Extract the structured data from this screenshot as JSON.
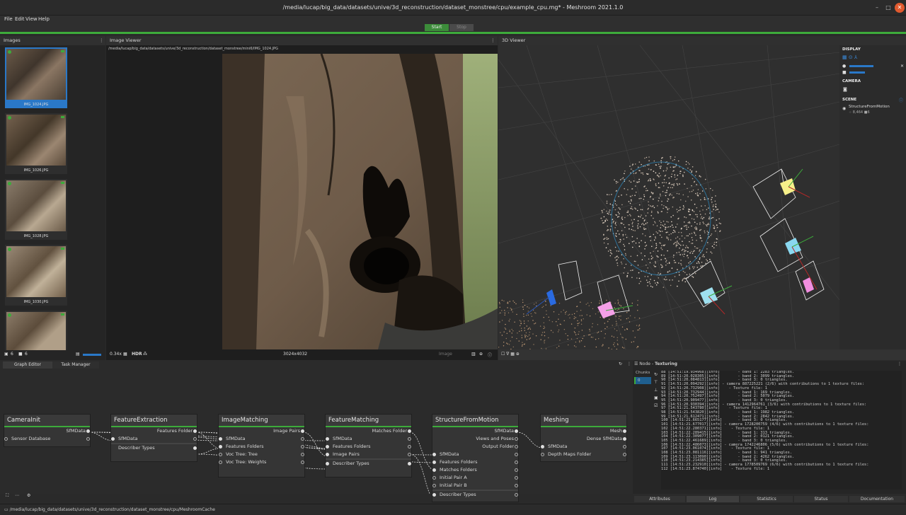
{
  "window": {
    "title": "/media/lucap/big_data/datasets/unive/3d_reconstruction/dataset_monstree/cpu/example_cpu.mg* - Meshroom 2021.1.0"
  },
  "menu": [
    "File",
    "Edit",
    "View",
    "Help"
  ],
  "toolbar": {
    "start": "Start",
    "stop": "Stop"
  },
  "images_panel": {
    "title": "Images",
    "items": [
      {
        "label": "IMG_1024.JPG"
      },
      {
        "label": "IMG_1026.JPG"
      },
      {
        "label": "IMG_1028.JPG"
      },
      {
        "label": "IMG_1030.JPG"
      },
      {
        "label": ""
      }
    ],
    "count_images": "6",
    "count_cameras": "6"
  },
  "image_viewer": {
    "title": "Image Viewer",
    "path": "/media/lucap/big_data/datasets/unive/3d_reconstruction/dataset_monstree/mini6/IMG_1024.JPG",
    "zoom": "0.34x",
    "hdr": "HDR",
    "resolution": "3024x4032",
    "mode": "Image"
  },
  "viewer3d": {
    "title": "3D Viewer",
    "display_label": "DISPLAY",
    "camera_label": "CAMERA",
    "scene_label": "SCENE",
    "scene_item": "StructureFromMotion",
    "scene_points": "8,464",
    "scene_cams": "6"
  },
  "tabs": {
    "graph_editor": "Graph Editor",
    "task_manager": "Task Manager"
  },
  "nodes": {
    "camerainit": {
      "title": "CameraInit",
      "out": "SfMData",
      "in1": "Sensor Database"
    },
    "featureextraction": {
      "title": "FeatureExtraction",
      "out": "Features Folder",
      "in1": "SfMData",
      "in2": "Describer Types"
    },
    "imagematching": {
      "title": "ImageMatching",
      "out": "Image Pairs",
      "in1": "SfMData",
      "in2": "Features Folders",
      "in3": "Voc Tree: Tree",
      "in4": "Voc Tree: Weights"
    },
    "featurematching": {
      "title": "FeatureMatching",
      "out": "Matches Folder",
      "in1": "SfMData",
      "in2": "Features Folders",
      "in3": "Image Pairs",
      "in4": "Describer Types"
    },
    "sfm": {
      "title": "StructureFromMotion",
      "out1": "SfMData",
      "out2": "Views and Poses",
      "out3": "Output Folder",
      "in1": "SfMData",
      "in2": "Features Folders",
      "in3": "Matches Folders",
      "in4": "Initial Pair A",
      "in5": "Initial Pair B",
      "in6": "Describer Types"
    },
    "meshing": {
      "title": "Meshing",
      "out1": "Mesh",
      "out2": "Dense SfMData",
      "in1": "SfMData",
      "in2": "Depth Maps Folder"
    }
  },
  "log_panel": {
    "node_label": "Node - ",
    "node_name": "Texturing",
    "chunks_label": "Chunks",
    "chunk0": "0",
    "lines": [
      "88 [14:51:19.934968][info]        - band 1: 2283 triangles.",
      "89 [14:51:20.028305][info]        - band 2: 3099 triangles.",
      "90 [14:51:20.084813][info]        - band 3: 0 triangles.",
      "91 [14:51:20.094292][info] - camera 887225221 (2/6) with contributions to 1 texture files:",
      "92 [14:51:20.732908][info]    - Texture file: 1",
      "93 [14:51:20.732944][info]        - band 1: 169 triangles.",
      "94 [14:51:20.752497][info]        - band 2: 5079 triangles.",
      "95 [14:51:20.909477][info]        - band 3: 0 triangles.",
      "96 [14:51:20.930394][info] - camera 1412964761 (3/6) with contributions to 1 texture files:",
      "97 [14:51:21.543780][info]    - Texture file: 1",
      "98 [14:51:21.543820][info]        - band 1: 1982 triangles.",
      "99 [14:51:21.612471][info]        - band 2: 2842 triangles.",
      "100 [14:51:21.665177][info]       - band 3: 0 triangles.",
      "101 [14:51:21.677017][info] - camera 1728200759 (4/6) with contributions to 1 texture files:",
      "102 [14:51:22.280371][info]    - Texture file: 1",
      "103 [14:51:22.289415][info]       - band 1: 313 triangles.",
      "104 [14:51:22.309077][info]       - band 2: 0121 triangles.",
      "105 [14:51:22.461689][info]       - band 3: 0 triangles.",
      "106 [14:51:22.486073][info] - camera 1742246806 (5/6) with contributions to 1 texture files:",
      "107 [14:51:23.061074][info]    - Texture file: 1",
      "108 [14:51:23.081116][info]       - band 1: 941 triangles.",
      "109 [14:51:23.113090][info]       - band 2: 4262 triangles.",
      "110 [14:51:23.214385][info]       - band 3: 0 triangles.",
      "111 [14:51:23.232910][info] - camera 1778509769 (6/6) with contributions to 1 texture files:",
      "112 [14:51:23.874740][info]    - Texture file: 1"
    ],
    "tabs": [
      "Attributes",
      "Log",
      "Statistics",
      "Status",
      "Documentation"
    ]
  },
  "statusbar": {
    "path": "/media/lucap/big_data/datasets/unive/3d_reconstruction/dataset_monstree/cpu/MeshroomCache"
  },
  "colors": {
    "accent": "#3dab3b",
    "selection": "#2a78c8"
  }
}
